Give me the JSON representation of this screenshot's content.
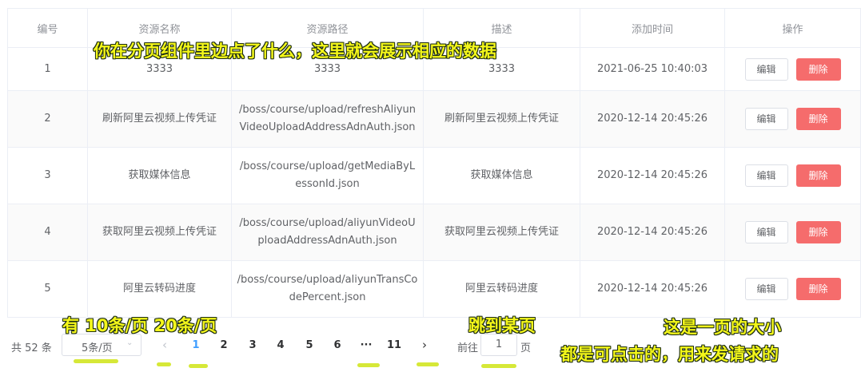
{
  "table": {
    "headers": [
      "编号",
      "资源名称",
      "资源路径",
      "描述",
      "添加时间",
      "操作"
    ],
    "edit_label": "编辑",
    "delete_label": "删除",
    "rows": [
      {
        "id": "1",
        "name": "3333",
        "path": "3333",
        "desc": "3333",
        "time": "2021-06-25 10:40:03"
      },
      {
        "id": "2",
        "name": "刷新阿里云视频上传凭证",
        "path": "/boss/course/upload/refreshAliyunVideoUploadAddressAdnAuth.json",
        "desc": "刷新阿里云视频上传凭证",
        "time": "2020-12-14 20:45:26"
      },
      {
        "id": "3",
        "name": "获取媒体信息",
        "path": "/boss/course/upload/getMediaByLessonId.json",
        "desc": "获取媒体信息",
        "time": "2020-12-14 20:45:26"
      },
      {
        "id": "4",
        "name": "获取阿里云视频上传凭证",
        "path": "/boss/course/upload/aliyunVideoUploadAddressAdnAuth.json",
        "desc": "获取阿里云视频上传凭证",
        "time": "2020-12-14 20:45:26"
      },
      {
        "id": "5",
        "name": "阿里云转码进度",
        "path": "/boss/course/upload/aliyunTransCodePercent.json",
        "desc": "阿里云转码进度",
        "time": "2020-12-14 20:45:26"
      }
    ]
  },
  "pagination": {
    "total": "共 52 条",
    "page_size": "5条/页",
    "pages": [
      "1",
      "2",
      "3",
      "4",
      "5",
      "6"
    ],
    "active_page": "1",
    "ellipsis": "···",
    "last_page": "11",
    "goto_label": "前往",
    "goto_value": "1",
    "page_unit": "页"
  },
  "annotations": {
    "top": "你在分页组件里边点了什么，这里就会展示相应的数据",
    "sizes": "有 10条/页 20条/页",
    "jump": "跳到某页",
    "size_note": "这是一页的大小",
    "clickable": "都是可点击的，用来发请求的"
  },
  "colors": {
    "primary": "#409eff",
    "danger": "#f56c6c",
    "annotation_text": "#f4f71a",
    "annotation_underline": "#d6e838"
  }
}
